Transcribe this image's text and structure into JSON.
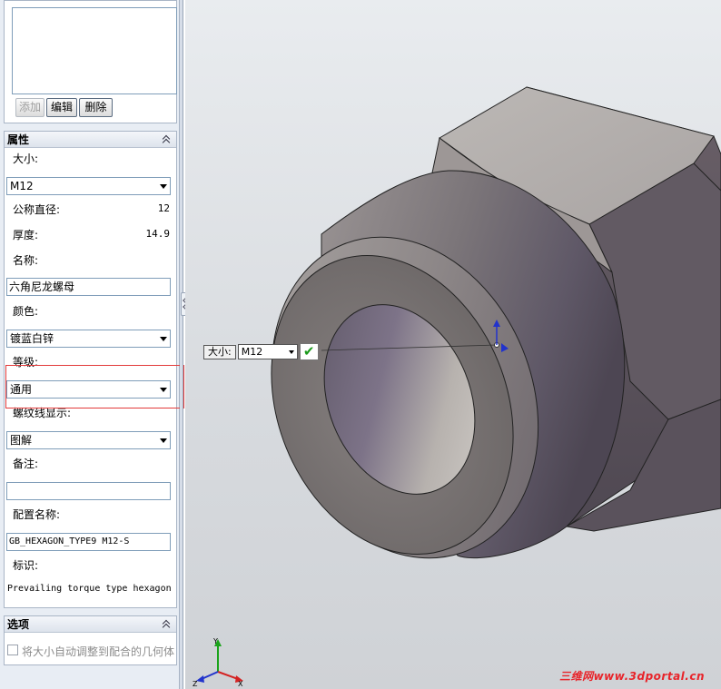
{
  "buttons": {
    "add": "添加",
    "edit": "编辑",
    "delete": "删除"
  },
  "properties": {
    "title": "属性",
    "size_label": "大小:",
    "size_value": "M12",
    "nominal_diameter_label": "公称直径:",
    "nominal_diameter_value": "12",
    "thickness_label": "厚度:",
    "thickness_value": "14.9",
    "name_label": "名称:",
    "name_value": "六角尼龙螺母",
    "color_label": "颜色:",
    "color_value": "镀蓝白锌",
    "grade_label": "等级:",
    "grade_value": "通用",
    "thread_display_label": "螺纹线显示:",
    "thread_display_value": "图解",
    "remark_label": "备注:",
    "remark_value": "",
    "config_name_label": "配置名称:",
    "config_name_value": "GB_HEXAGON_TYPE9 M12-S",
    "identifier_label": "标识:",
    "identifier_value": "Prevailing torque type hexagon"
  },
  "options": {
    "title": "选项",
    "auto_resize_label": "将大小自动调整到配合的几何体"
  },
  "popup": {
    "label": "大小:",
    "value": "M12"
  },
  "triad": {
    "x": "X",
    "y": "Y",
    "z": "Z"
  },
  "watermark": "三维网www.3dportal.cn",
  "colors": {
    "accent_check": "#1a9a1a",
    "highlight_box": "#e23a3a",
    "watermark": "#e8242a"
  }
}
